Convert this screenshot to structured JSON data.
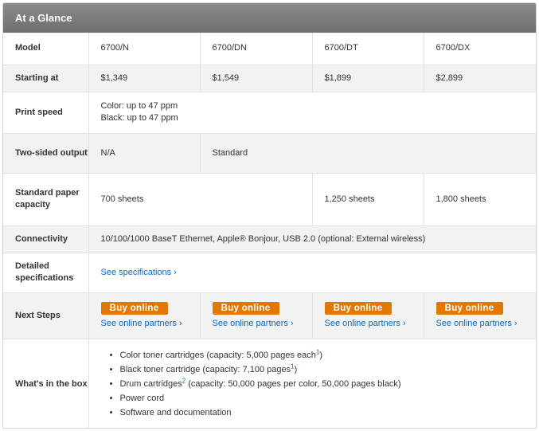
{
  "title": "At a Glance",
  "rows": {
    "model": {
      "label": "Model",
      "values": [
        "6700/N",
        "6700/DN",
        "6700/DT",
        "6700/DX"
      ]
    },
    "starting": {
      "label": "Starting at",
      "values": [
        "$1,349",
        "$1,549",
        "$1,899",
        "$2,899"
      ]
    },
    "speed": {
      "label": "Print speed",
      "lines": [
        "Color: up to 47 ppm",
        "Black: up to 47 ppm"
      ]
    },
    "twosided": {
      "label": "Two-sided output",
      "values": [
        "N/A",
        "Standard"
      ]
    },
    "paper": {
      "label": "Standard paper capacity",
      "values": [
        "700 sheets",
        "1,250 sheets",
        "1,800 sheets"
      ]
    },
    "connectivity": {
      "label": "Connectivity",
      "value": "10/100/1000 BaseT Ethernet, Apple® Bonjour, USB 2.0 (optional: External wireless)"
    },
    "specs": {
      "label": "Detailed specifications",
      "link": "See specifications"
    },
    "next": {
      "label": "Next Steps",
      "buy": "Buy online",
      "partners": "See online partners"
    },
    "box": {
      "label": "What's in the box",
      "items": [
        {
          "text": "Color toner cartridges (capacity: 5,000 pages each",
          "sup": "1",
          "after": ")"
        },
        {
          "text": "Black toner cartridge (capacity: 7,100 pages",
          "sup": "1",
          "after": ")"
        },
        {
          "text": "Drum cartridges",
          "sup": "2",
          "after": " (capacity: 50,000 pages per color, 50,000 pages black)"
        },
        {
          "text": "Power cord"
        },
        {
          "text": "Software and documentation"
        }
      ]
    }
  },
  "chevron": "›",
  "colors": {
    "header": "#7c7c7c",
    "buy": "#e27800",
    "link": "#0a69c7",
    "alt_row": "#f2f2f2"
  }
}
